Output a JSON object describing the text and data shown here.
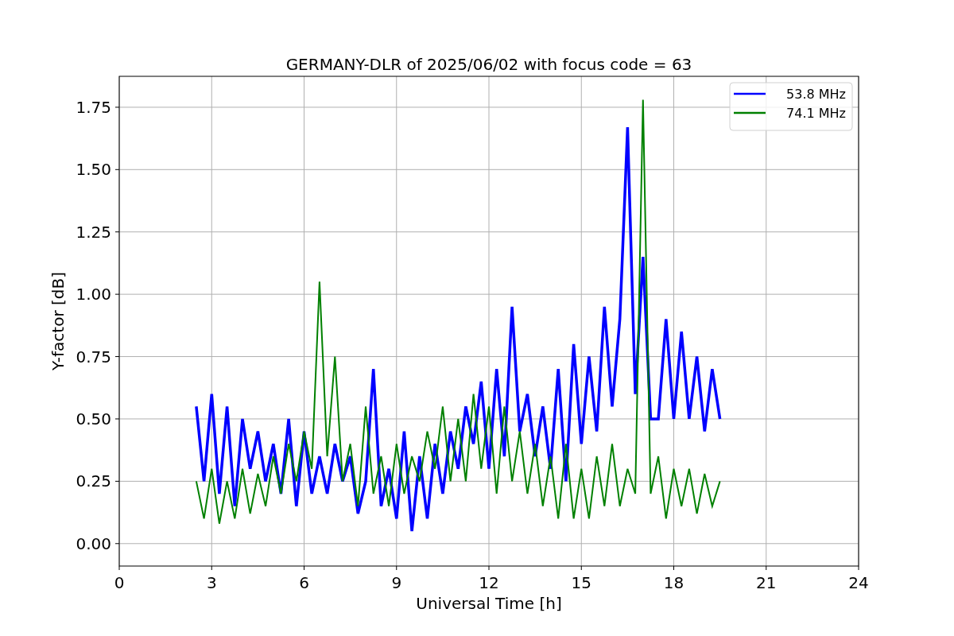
{
  "chart_data": {
    "type": "line",
    "title": "GERMANY-DLR of 2025/06/02 with focus code = 63",
    "xlabel": "Universal Time [h]",
    "ylabel": "Y-factor [dB]",
    "x": [
      2.5,
      2.75,
      3,
      3.25,
      3.5,
      3.75,
      4,
      4.25,
      4.5,
      4.75,
      5,
      5.25,
      5.5,
      5.75,
      6,
      6.25,
      6.5,
      6.75,
      7,
      7.25,
      7.5,
      7.75,
      8,
      8.25,
      8.5,
      8.75,
      9,
      9.25,
      9.5,
      9.75,
      10,
      10.25,
      10.5,
      10.75,
      11,
      11.25,
      11.5,
      11.75,
      12,
      12.25,
      12.5,
      12.75,
      13,
      13.25,
      13.5,
      13.75,
      14,
      14.25,
      14.5,
      14.75,
      15,
      15.25,
      15.5,
      15.75,
      16,
      16.25,
      16.5,
      16.75,
      17,
      17.25,
      17.5,
      17.75,
      18,
      18.25,
      18.5,
      18.75,
      19,
      19.25,
      19.5
    ],
    "series": [
      {
        "name": "53.8 MHz",
        "color": "#0000ff",
        "values": [
          0.55,
          0.25,
          0.6,
          0.2,
          0.55,
          0.15,
          0.5,
          0.3,
          0.45,
          0.25,
          0.4,
          0.2,
          0.5,
          0.15,
          0.45,
          0.2,
          0.35,
          0.2,
          0.4,
          0.25,
          0.35,
          0.12,
          0.25,
          0.7,
          0.15,
          0.3,
          0.1,
          0.45,
          0.05,
          0.35,
          0.1,
          0.4,
          0.2,
          0.45,
          0.3,
          0.55,
          0.4,
          0.65,
          0.3,
          0.7,
          0.35,
          0.95,
          0.45,
          0.6,
          0.35,
          0.55,
          0.3,
          0.7,
          0.25,
          0.8,
          0.4,
          0.75,
          0.45,
          0.95,
          0.55,
          0.9,
          1.67,
          0.6,
          1.15,
          0.5,
          0.5,
          0.9,
          0.5,
          0.85,
          0.5,
          0.75,
          0.45,
          0.7,
          0.5
        ]
      },
      {
        "name": "74.1 MHz",
        "color": "#008000",
        "values": [
          0.25,
          0.1,
          0.3,
          0.08,
          0.25,
          0.1,
          0.3,
          0.12,
          0.28,
          0.15,
          0.35,
          0.2,
          0.4,
          0.25,
          0.45,
          0.3,
          1.05,
          0.35,
          0.75,
          0.25,
          0.4,
          0.15,
          0.55,
          0.2,
          0.35,
          0.15,
          0.4,
          0.2,
          0.35,
          0.25,
          0.45,
          0.3,
          0.55,
          0.25,
          0.5,
          0.25,
          0.6,
          0.3,
          0.55,
          0.2,
          0.55,
          0.25,
          0.45,
          0.2,
          0.4,
          0.15,
          0.35,
          0.1,
          0.4,
          0.1,
          0.3,
          0.1,
          0.35,
          0.15,
          0.4,
          0.15,
          0.3,
          0.2,
          1.78,
          0.2,
          0.35,
          0.1,
          0.3,
          0.15,
          0.3,
          0.12,
          0.28,
          0.15,
          0.25
        ]
      }
    ],
    "grid": true,
    "legend": true,
    "xlim": [
      0,
      24
    ],
    "ylim": [
      -0.09,
      1.874
    ],
    "xticks": [
      0,
      3,
      6,
      9,
      12,
      15,
      18,
      21,
      24
    ],
    "yticks": [
      {
        "value": 0,
        "label": "0.00"
      },
      {
        "value": 0.25,
        "label": "0.25"
      },
      {
        "value": 0.5,
        "label": "0.50"
      },
      {
        "value": 0.75,
        "label": "0.75"
      },
      {
        "value": 1,
        "label": "1.00"
      },
      {
        "value": 1.25,
        "label": "1.25"
      },
      {
        "value": 1.5,
        "label": "1.50"
      },
      {
        "value": 1.75,
        "label": "1.75"
      }
    ]
  }
}
